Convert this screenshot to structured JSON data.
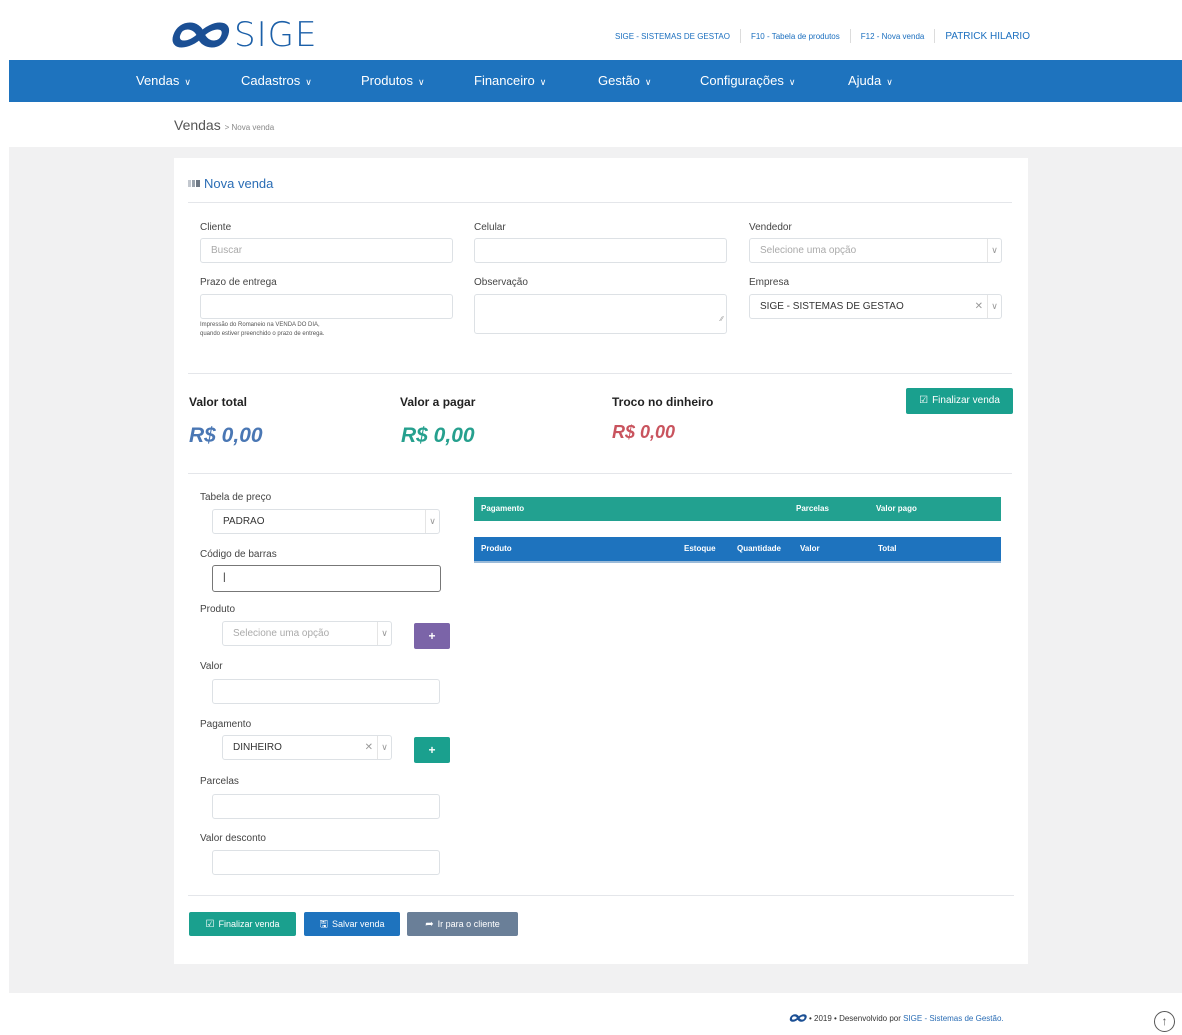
{
  "header": {
    "logo_text": "SIGE",
    "links": [
      "SIGE - SISTEMAS DE GESTAO",
      "F10 - Tabela de produtos",
      "F12 - Nova venda"
    ],
    "user": "PATRICK HILARIO"
  },
  "nav": {
    "items": [
      {
        "label": "Vendas"
      },
      {
        "label": "Cadastros"
      },
      {
        "label": "Produtos"
      },
      {
        "label": "Financeiro"
      },
      {
        "label": "Gestão"
      },
      {
        "label": "Configurações"
      },
      {
        "label": "Ajuda"
      }
    ]
  },
  "breadcrumb": {
    "title": "Vendas",
    "sub": "> Nova venda"
  },
  "card": {
    "title": "Nova venda"
  },
  "form": {
    "cliente_label": "Cliente",
    "cliente_placeholder": "Buscar",
    "celular_label": "Celular",
    "vendedor_label": "Vendedor",
    "vendedor_placeholder": "Selecione uma opção",
    "prazo_label": "Prazo de entrega",
    "prazo_hint_1": "Impressão do Romaneio na VENDA DO DIA,",
    "prazo_hint_2": "quando estiver preenchido o prazo de entrega.",
    "observacao_label": "Observação",
    "empresa_label": "Empresa",
    "empresa_value": "SIGE - SISTEMAS DE GESTAO"
  },
  "summary": {
    "total_label": "Valor total",
    "total_value": "R$ 0,00",
    "pagar_label": "Valor a pagar",
    "pagar_value": "R$ 0,00",
    "troco_label": "Troco no dinheiro",
    "troco_value": "R$ 0,00",
    "finalizar_label": "Finalizar venda"
  },
  "left": {
    "tabela_label": "Tabela de preço",
    "tabela_value": "PADRAO",
    "codigo_label": "Código de barras",
    "produto_label": "Produto",
    "produto_placeholder": "Selecione uma opção",
    "valor_label": "Valor",
    "pagamento_label": "Pagamento",
    "pagamento_value": "DINHEIRO",
    "parcelas_label": "Parcelas",
    "desconto_label": "Valor desconto",
    "add_symbol": "+"
  },
  "pagamento_table": {
    "columns": [
      "Pagamento",
      "Parcelas",
      "Valor pago"
    ]
  },
  "produto_table": {
    "columns": [
      "Produto",
      "Estoque",
      "Quantidade",
      "Valor",
      "Total"
    ]
  },
  "actions": {
    "finalizar": "Finalizar venda",
    "salvar": "Salvar venda",
    "cliente": "Ir para o cliente"
  },
  "footer": {
    "year_text": "• 2019 • Desenvolvido por",
    "link_text": "SIGE - Sistemas de Gestão."
  },
  "colors": {
    "primary": "#1e73be",
    "teal": "#1aa08e",
    "total_value": "#4a77b4",
    "pagar_value": "#26a08e",
    "troco_value": "#c9545e"
  }
}
